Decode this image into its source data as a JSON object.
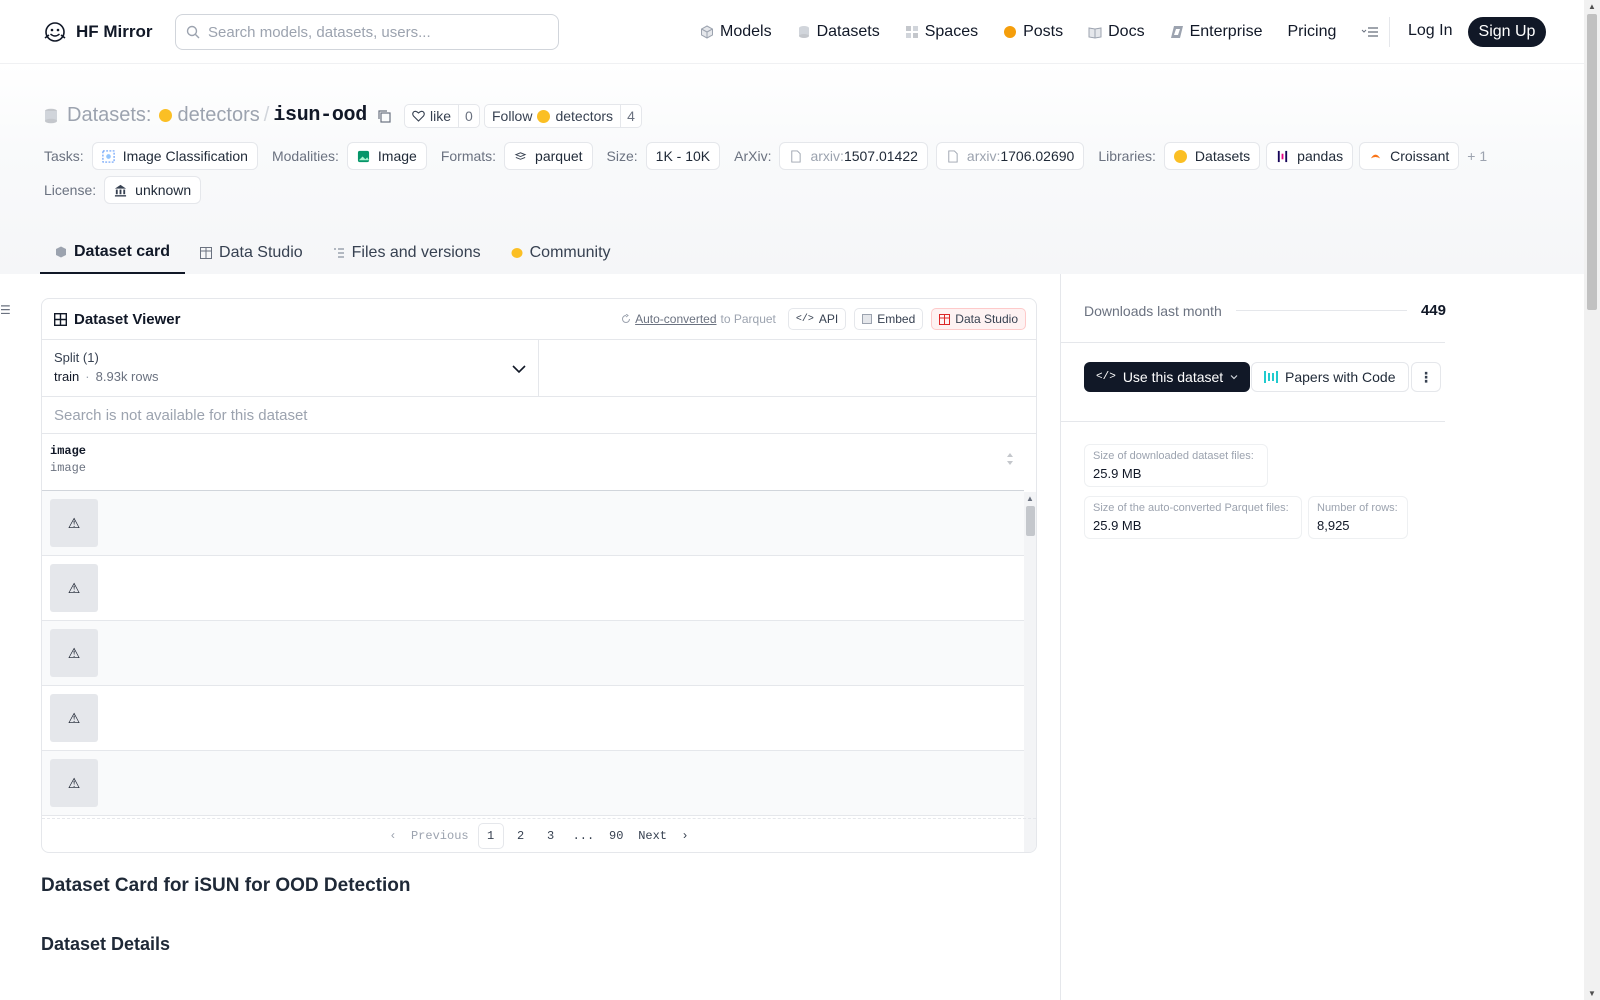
{
  "brand": {
    "name": "HF Mirror"
  },
  "search": {
    "placeholder": "Search models, datasets, users..."
  },
  "nav": {
    "items": [
      {
        "label": "Models",
        "icon": "cube-icon",
        "color": "#6b7280"
      },
      {
        "label": "Datasets",
        "icon": "database-icon",
        "color": "#9ca3af"
      },
      {
        "label": "Spaces",
        "icon": "grid-icon",
        "color": "#9ca3af"
      },
      {
        "label": "Posts",
        "icon": "posts-icon",
        "color": "#f59e0b"
      },
      {
        "label": "Docs",
        "icon": "book-icon",
        "color": "#9ca3af"
      },
      {
        "label": "Enterprise",
        "icon": "enterprise-icon",
        "color": "#9ca3af"
      },
      {
        "label": "Pricing",
        "icon": "",
        "color": ""
      }
    ],
    "login": "Log In",
    "signup": "Sign Up"
  },
  "repo": {
    "type_label": "Datasets:",
    "owner": "detectors",
    "slash": "/",
    "name": "isun-ood",
    "like_label": "like",
    "like_count": "0",
    "follow_label": "Follow",
    "follow_owner": "detectors",
    "follow_count": "4"
  },
  "meta": {
    "tasks_label": "Tasks:",
    "tasks": [
      "Image Classification"
    ],
    "modalities_label": "Modalities:",
    "modalities": [
      "Image"
    ],
    "formats_label": "Formats:",
    "formats": [
      "parquet"
    ],
    "size_label": "Size:",
    "size": "1K - 10K",
    "arxiv_label": "ArXiv:",
    "arxiv_prefix": "arxiv:",
    "arxiv": [
      "1507.01422",
      "1706.02690"
    ],
    "libraries_label": "Libraries:",
    "libraries": [
      "Datasets",
      "pandas",
      "Croissant"
    ],
    "libraries_more": "+ 1",
    "license_label": "License:",
    "license": "unknown"
  },
  "tabs": [
    {
      "label": "Dataset card",
      "active": true
    },
    {
      "label": "Data Studio",
      "active": false
    },
    {
      "label": "Files and versions",
      "active": false
    },
    {
      "label": "Community",
      "active": false
    }
  ],
  "viewer": {
    "title": "Dataset Viewer",
    "auto_converted": "Auto-converted",
    "to_parquet": "to Parquet",
    "api": "API",
    "embed": "Embed",
    "data_studio": "Data Studio",
    "split_label": "Split (1)",
    "split_name": "train",
    "split_sep": "·",
    "split_rows": "8.93k rows",
    "search_placeholder": "Search is not available for this dataset",
    "column_name": "image",
    "column_type": "image",
    "row_count_visible": 5,
    "pager": {
      "previous": "Previous",
      "pages": [
        "1",
        "2",
        "3",
        "...",
        "90"
      ],
      "active": "1",
      "next": "Next"
    }
  },
  "content": {
    "card_title": "Dataset Card for iSUN for OOD Detection",
    "details_title": "Dataset Details"
  },
  "sidebar": {
    "downloads_label": "Downloads last month",
    "downloads_value": "449",
    "use_button": "Use this dataset",
    "pwc_button": "Papers with Code",
    "stats": {
      "dl_size_label": "Size of downloaded dataset files:",
      "dl_size_value": "25.9 MB",
      "parquet_size_label": "Size of the auto-converted Parquet files:",
      "parquet_size_value": "25.9 MB",
      "rows_label": "Number of rows:",
      "rows_value": "8,925"
    }
  }
}
